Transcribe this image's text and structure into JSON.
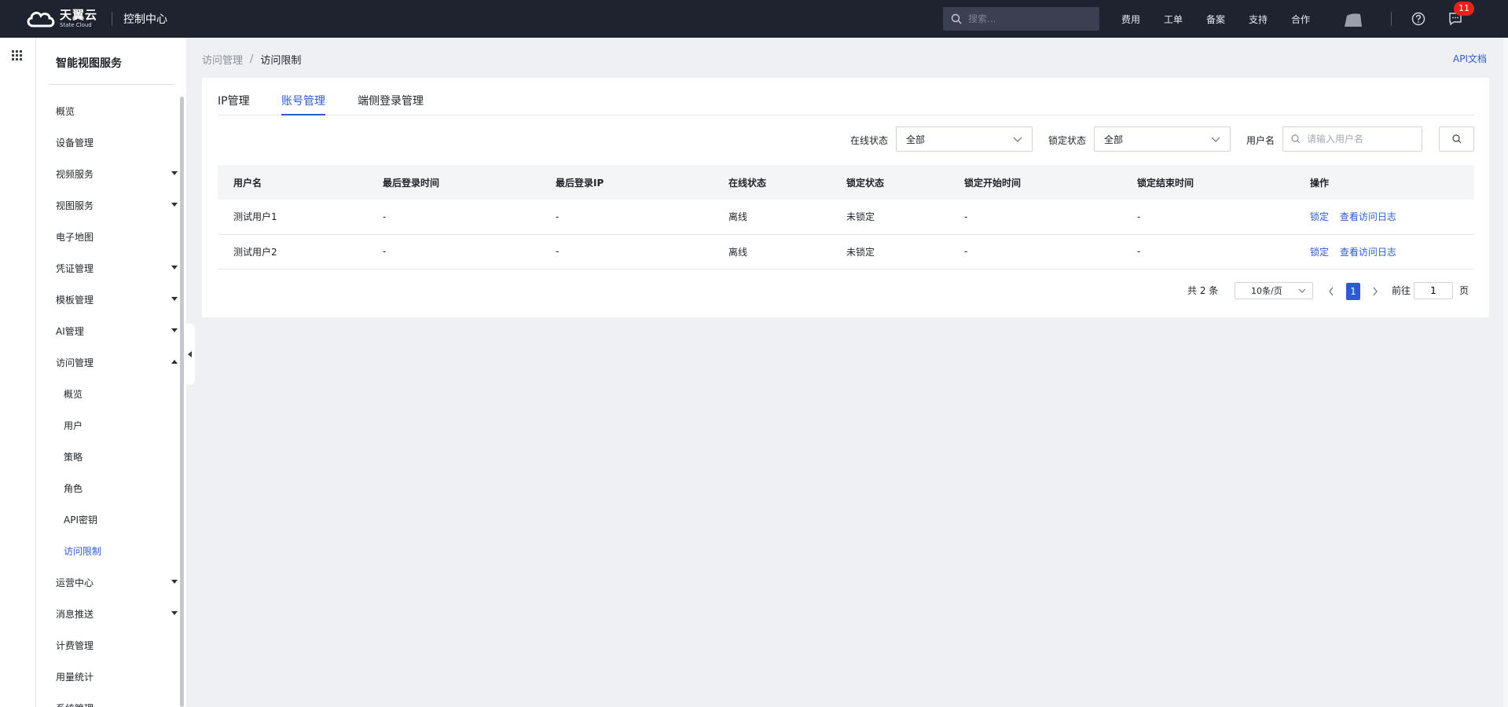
{
  "topbar": {
    "logo_cn": "天翼云",
    "logo_en": "State Cloud",
    "console": "控制中心",
    "search_placeholder": "搜索...",
    "links": [
      "费用",
      "工单",
      "备案",
      "支持",
      "合作"
    ],
    "notification_count": "11"
  },
  "sidebar": {
    "title": "智能视图服务",
    "items": [
      {
        "label": "概览"
      },
      {
        "label": "设备管理"
      },
      {
        "label": "视频服务"
      },
      {
        "label": "视图服务"
      },
      {
        "label": "电子地图"
      },
      {
        "label": "凭证管理"
      },
      {
        "label": "模板管理"
      },
      {
        "label": "AI管理"
      },
      {
        "label": "访问管理"
      },
      {
        "label": "概览"
      },
      {
        "label": "用户"
      },
      {
        "label": "策略"
      },
      {
        "label": "角色"
      },
      {
        "label": "API密钥"
      },
      {
        "label": "访问限制"
      },
      {
        "label": "运营中心"
      },
      {
        "label": "消息推送"
      },
      {
        "label": "计费管理"
      },
      {
        "label": "用量统计"
      },
      {
        "label": "系统管理"
      }
    ]
  },
  "breadcrumb": {
    "parent": "访问管理",
    "separator": "/",
    "current": "访问限制"
  },
  "api_doc": "API文档",
  "tabs": [
    "IP管理",
    "账号管理",
    "端侧登录管理"
  ],
  "filters": {
    "online_label": "在线状态",
    "online_value": "全部",
    "lock_label": "锁定状态",
    "lock_value": "全部",
    "username_label": "用户名",
    "username_placeholder": "请输入用户名"
  },
  "table": {
    "headers": [
      "用户名",
      "最后登录时间",
      "最后登录IP",
      "在线状态",
      "锁定状态",
      "锁定开始时间",
      "锁定结束时间",
      "操作"
    ],
    "rows": [
      {
        "name": "测试用户1",
        "last_time": "-",
        "last_ip": "-",
        "online": "离线",
        "lock": "未锁定",
        "lock_start": "-",
        "lock_end": "-"
      },
      {
        "name": "测试用户2",
        "last_time": "-",
        "last_ip": "-",
        "online": "离线",
        "lock": "未锁定",
        "lock_start": "-",
        "lock_end": "-"
      }
    ],
    "action_lock": "锁定",
    "action_log": "查看访问日志"
  },
  "pagination": {
    "total": "共 2 条",
    "page_size": "10条/页",
    "current": "1",
    "goto_label": "前往",
    "goto_value": "1",
    "page_unit": "页"
  },
  "colors": {
    "accent": "#2d5bd6",
    "topbar": "#1f2330",
    "badge": "#e3241b"
  }
}
